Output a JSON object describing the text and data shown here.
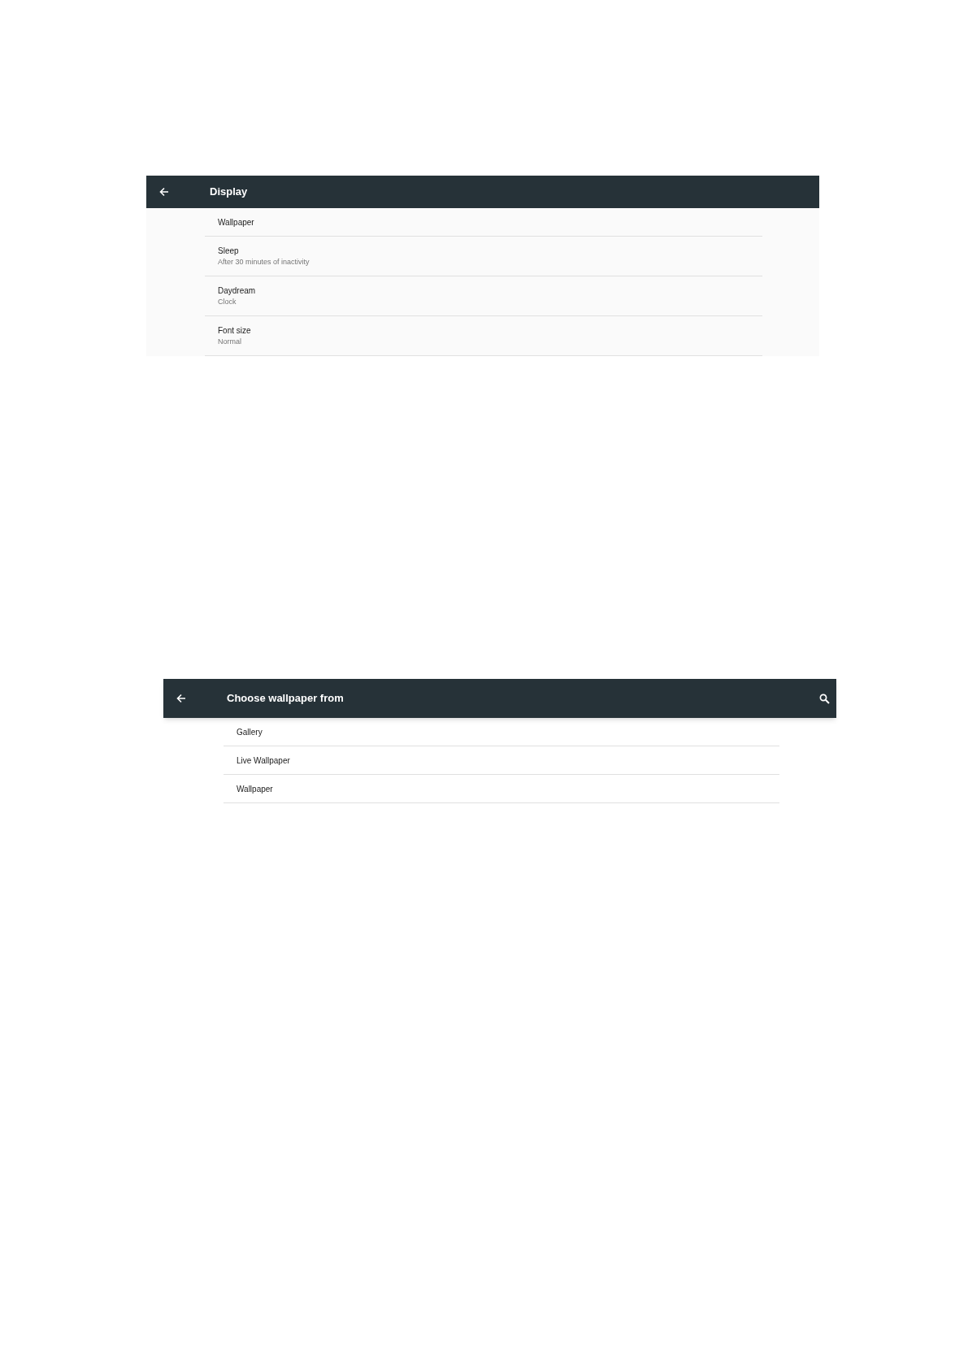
{
  "screens": [
    {
      "title": "Display",
      "search": false,
      "items": [
        {
          "title": "Wallpaper"
        },
        {
          "title": "Sleep",
          "summary": "After 30 minutes of inactivity"
        },
        {
          "title": "Daydream",
          "summary": "Clock"
        },
        {
          "title": "Font size",
          "summary": "Normal"
        }
      ]
    },
    {
      "title": "Choose wallpaper from",
      "search": true,
      "items": [
        {
          "title": "Gallery"
        },
        {
          "title": "Live Wallpaper"
        },
        {
          "title": "Wallpaper"
        }
      ]
    }
  ]
}
